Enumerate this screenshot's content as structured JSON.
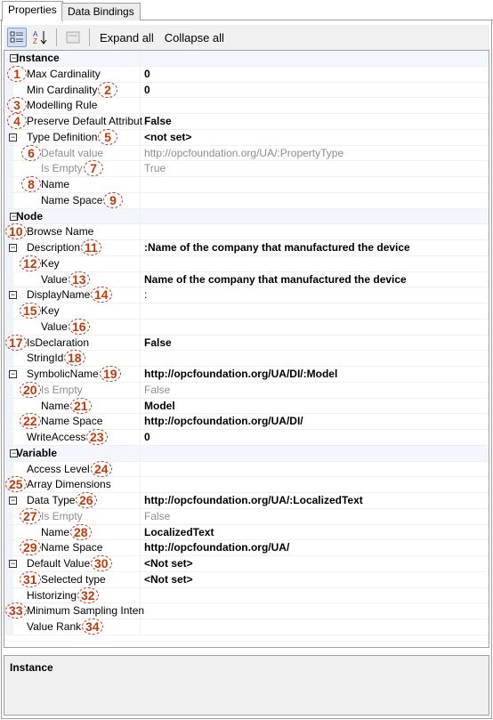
{
  "tabs": [
    {
      "label": "Properties",
      "active": true
    },
    {
      "label": "Data Bindings",
      "active": false
    }
  ],
  "toolbar": {
    "categorized_icon": "categorized-icon",
    "alpha_icon": "sort-alphabetical-icon",
    "property_pages_icon": "property-pages-icon",
    "sort_glyph": "A↓",
    "expand_all": "Expand all",
    "collapse_all": "Collapse all"
  },
  "accent": {
    "marker": "#c0390b",
    "category_bg": "#f3f7fc"
  },
  "rows": [
    {
      "label": "Instance",
      "level": 0,
      "cat": true,
      "toggle": "⊟"
    },
    {
      "label": "Max Cardinality",
      "level": 1,
      "value": "0",
      "bold": true,
      "marker": "1",
      "mpos": "before"
    },
    {
      "label": "Min Cardinality",
      "level": 1,
      "value": "0",
      "bold": true,
      "marker": "2",
      "mpos": "after"
    },
    {
      "label": "Modelling Rule",
      "level": 1,
      "value": "",
      "marker": "3",
      "mpos": "before"
    },
    {
      "label": "Preserve Default Attribut",
      "level": 1,
      "value": "False",
      "bold": true,
      "marker": "4",
      "mpos": "before"
    },
    {
      "label": "Type Definition",
      "level": 1,
      "toggle": "⊟",
      "value": "<not set>",
      "bold": true,
      "marker": "5",
      "mpos": "after"
    },
    {
      "label": "Default value",
      "level": 2,
      "value": "http://opcfoundation.org/UA/:PropertyType",
      "gray": true,
      "marker": "6",
      "mpos": "before"
    },
    {
      "label": "Is Empty",
      "level": 2,
      "value": "True",
      "gray": true,
      "marker": "7",
      "mpos": "after"
    },
    {
      "label": "Name",
      "level": 2,
      "value": "",
      "marker": "8",
      "mpos": "before"
    },
    {
      "label": "Name Space",
      "level": 2,
      "value": "",
      "marker": "9",
      "mpos": "after"
    },
    {
      "label": "Node",
      "level": 0,
      "cat": true,
      "toggle": "⊟"
    },
    {
      "label": "Browse Name",
      "level": 1,
      "value": "",
      "marker": "10",
      "mpos": "before"
    },
    {
      "label": "Description",
      "level": 1,
      "toggle": "⊟",
      "value": ":Name of the company that manufactured the device",
      "bold": true,
      "marker": "11",
      "mpos": "after"
    },
    {
      "label": "Key",
      "level": 2,
      "value": "",
      "marker": "12",
      "mpos": "before"
    },
    {
      "label": "Value",
      "level": 2,
      "value": "Name of the company that manufactured the device",
      "bold": true,
      "marker": "13",
      "mpos": "after"
    },
    {
      "label": "DisplayName",
      "level": 1,
      "toggle": "⊟",
      "value": ":",
      "marker": "14",
      "mpos": "after"
    },
    {
      "label": "Key",
      "level": 2,
      "value": "",
      "marker": "15",
      "mpos": "before"
    },
    {
      "label": "Value",
      "level": 2,
      "value": "",
      "marker": "16",
      "mpos": "after"
    },
    {
      "label": "IsDeclaration",
      "level": 1,
      "value": "False",
      "bold": true,
      "marker": "17",
      "mpos": "before"
    },
    {
      "label": "StringId",
      "level": 1,
      "value": "",
      "marker": "18",
      "mpos": "after"
    },
    {
      "label": "SymbolicName",
      "level": 1,
      "toggle": "⊟",
      "value": "http://opcfoundation.org/UA/DI/:Model",
      "bold": true,
      "marker": "19",
      "mpos": "after"
    },
    {
      "label": "Is Empty",
      "level": 2,
      "value": "False",
      "gray": true,
      "marker": "20",
      "mpos": "before"
    },
    {
      "label": "Name",
      "level": 2,
      "value": "Model",
      "bold": true,
      "marker": "21",
      "mpos": "after"
    },
    {
      "label": "Name Space",
      "level": 2,
      "value": "http://opcfoundation.org/UA/DI/",
      "bold": true,
      "marker": "22",
      "mpos": "before"
    },
    {
      "label": "WriteAccess",
      "level": 1,
      "value": "0",
      "bold": true,
      "marker": "23",
      "mpos": "after"
    },
    {
      "label": "Variable",
      "level": 0,
      "cat": true,
      "toggle": "⊟"
    },
    {
      "label": "Access Level",
      "level": 1,
      "value": "",
      "marker": "24",
      "mpos": "after"
    },
    {
      "label": "Array Dimensions",
      "level": 1,
      "value": "",
      "marker": "25",
      "mpos": "before"
    },
    {
      "label": "Data Type",
      "level": 1,
      "toggle": "⊟",
      "value": "http://opcfoundation.org/UA/:LocalizedText",
      "bold": true,
      "marker": "26",
      "mpos": "after"
    },
    {
      "label": "Is Empty",
      "level": 2,
      "value": "False",
      "gray": true,
      "marker": "27",
      "mpos": "before"
    },
    {
      "label": "Name",
      "level": 2,
      "value": "LocalizedText",
      "bold": true,
      "marker": "28",
      "mpos": "after"
    },
    {
      "label": "Name Space",
      "level": 2,
      "value": "http://opcfoundation.org/UA/",
      "bold": true,
      "marker": "29",
      "mpos": "before"
    },
    {
      "label": "Default Value",
      "level": 1,
      "toggle": "⊟",
      "value": "<Not set>",
      "bold": true,
      "marker": "30",
      "mpos": "after"
    },
    {
      "label": "Selected type",
      "level": 2,
      "value": "<Not set>",
      "bold": true,
      "marker": "31",
      "mpos": "before"
    },
    {
      "label": "Historizing",
      "level": 1,
      "value": "",
      "marker": "32",
      "mpos": "after"
    },
    {
      "label": "Minimum Sampling Inten",
      "level": 1,
      "value": "",
      "marker": "33",
      "mpos": "before"
    },
    {
      "label": "Value Rank",
      "level": 1,
      "value": "",
      "marker": "34",
      "mpos": "after"
    }
  ],
  "description": {
    "title": "Instance"
  }
}
